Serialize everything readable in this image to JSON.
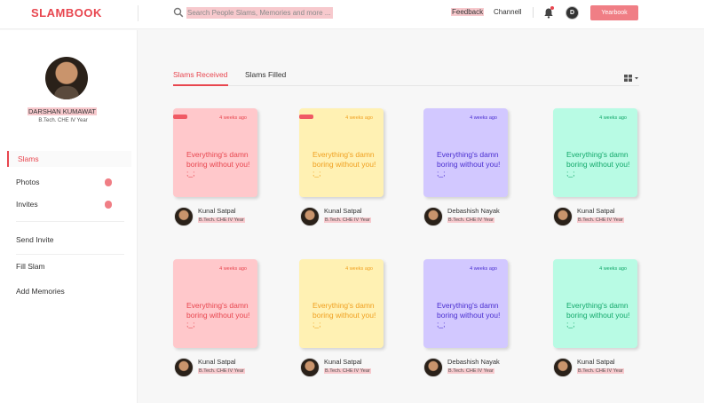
{
  "header": {
    "logo": "SLAMBOOK",
    "search_placeholder": "Search People Slams, Memories and more ...",
    "feedback_label": "Feedback",
    "channel_label": "Channell",
    "avatar_initial": "D",
    "cta_label": "Yearbook"
  },
  "profile": {
    "name": "DARSHAN KUMAWAT",
    "subtitle": "B.Tech. CHE IV Year"
  },
  "sidebar": {
    "items": [
      {
        "label": "Slams"
      },
      {
        "label": "Photos"
      },
      {
        "label": "Invites"
      },
      {
        "label": "Send Invite"
      },
      {
        "label": "Fill Slam"
      },
      {
        "label": "Add Memories"
      }
    ]
  },
  "tabs": [
    {
      "label": "Slams Received"
    },
    {
      "label": "Slams Filled"
    }
  ],
  "cards": [
    {
      "time": "4 weeks ago",
      "text": "Everything's damn boring without you! ;_;",
      "author": "Kunal Satpal",
      "author_sub": "B.Tech. CHE IV Year",
      "color": "#ffc8cb"
    },
    {
      "time": "4 weeks ago",
      "text": "Everything's damn boring without you! ;_;",
      "author": "Kunal Satpal",
      "author_sub": "B.Tech. CHE IV Year",
      "color": "#fff1b3"
    },
    {
      "time": "4 weeks ago",
      "text": "Everything's damn boring without you! ;_;",
      "author": "Debashish Nayak",
      "author_sub": "B.Tech. CHE IV Year",
      "color": "#d2c8ff"
    },
    {
      "time": "4 weeks ago",
      "text": "Everything's damn boring without you! ;_;",
      "author": "Kunal Satpal",
      "author_sub": "B.Tech. CHE IV Year",
      "color": "#b8fbe4"
    },
    {
      "time": "4 weeks ago",
      "text": "Everything's damn boring without you! ;_;",
      "author": "Kunal Satpal",
      "author_sub": "B.Tech. CHE IV Year",
      "color": "#ffc8cb"
    },
    {
      "time": "4 weeks ago",
      "text": "Everything's damn boring without you! ;_;",
      "author": "Kunal Satpal",
      "author_sub": "B.Tech. CHE IV Year",
      "color": "#fff1b3"
    },
    {
      "time": "4 weeks ago",
      "text": "Everything's damn boring without you! ;_;",
      "author": "Debashish Nayak",
      "author_sub": "B.Tech. CHE IV Year",
      "color": "#d2c8ff"
    },
    {
      "time": "4 weeks ago",
      "text": "Everything's damn boring without you! ;_;",
      "author": "Kunal Satpal",
      "author_sub": "B.Tech. CHE IV Year",
      "color": "#b8fbe4"
    }
  ],
  "colors": {
    "accent": "#e8464f",
    "pink_text": "#e8464f",
    "yellow_text": "#f0a020",
    "purple_text": "#4a2fd0",
    "green_text": "#12a86a"
  }
}
